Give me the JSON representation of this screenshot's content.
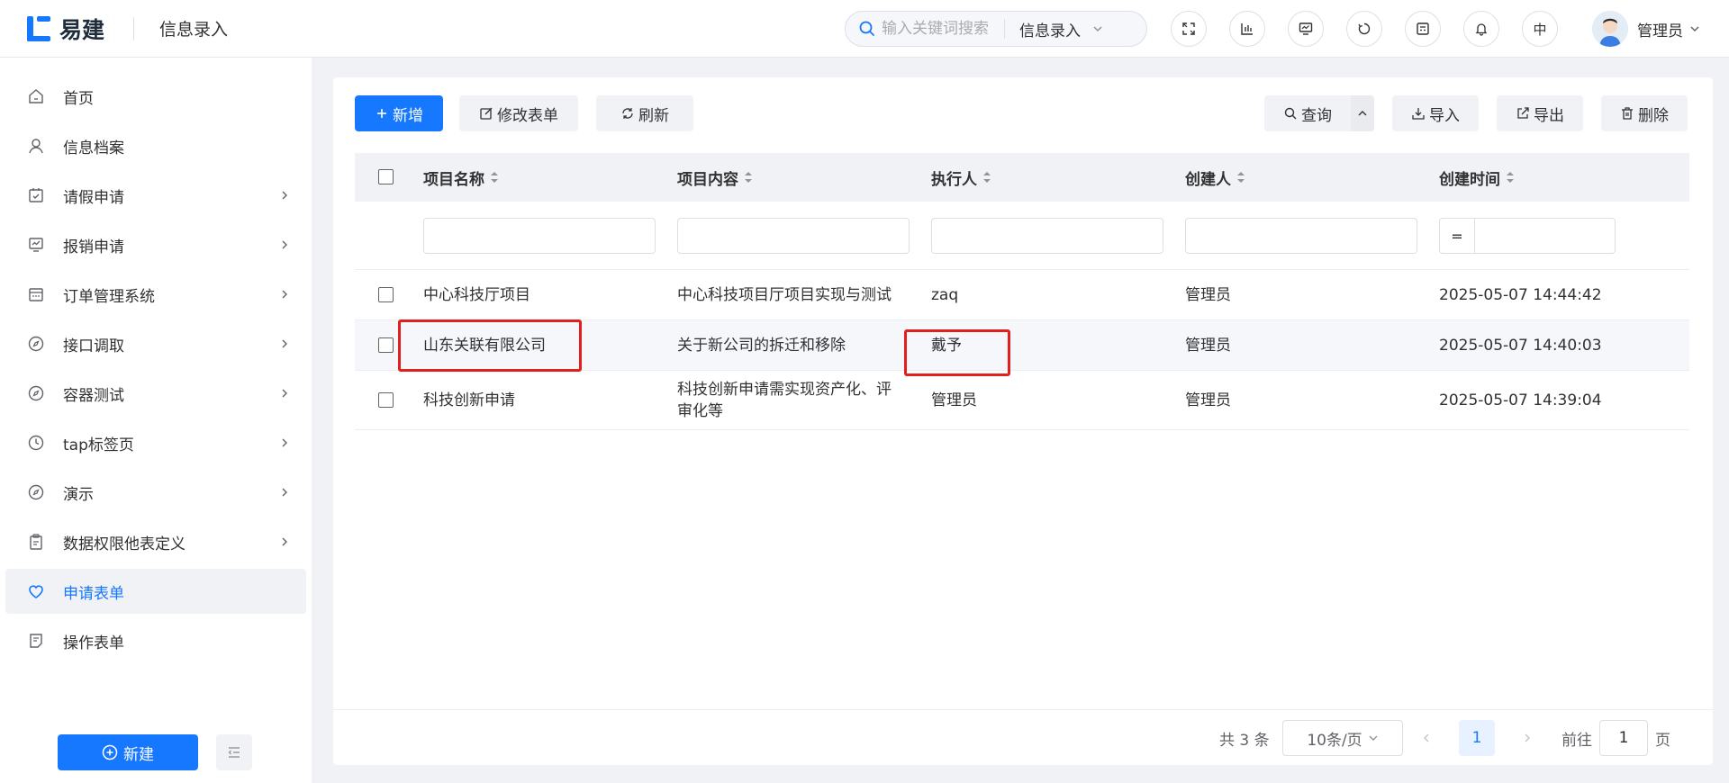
{
  "header": {
    "logo_text": "易建",
    "section_title": "信息录入",
    "search_placeholder": "输入关键词搜索",
    "search_scope": "信息录入",
    "lang_label": "中",
    "user_name": "管理员"
  },
  "sidebar": {
    "items": [
      {
        "label": "首页",
        "icon": "home-icon",
        "has_children": false
      },
      {
        "label": "信息档案",
        "icon": "user-icon",
        "has_children": false
      },
      {
        "label": "请假申请",
        "icon": "calendar-check-icon",
        "has_children": true
      },
      {
        "label": "报销申请",
        "icon": "chart-board-icon",
        "has_children": true
      },
      {
        "label": "订单管理系统",
        "icon": "calendar-icon",
        "has_children": true
      },
      {
        "label": "接口调取",
        "icon": "compass-icon",
        "has_children": true
      },
      {
        "label": "容器测试",
        "icon": "compass-icon",
        "has_children": true
      },
      {
        "label": "tap标签页",
        "icon": "clock-icon",
        "has_children": true
      },
      {
        "label": "演示",
        "icon": "compass-icon",
        "has_children": true
      },
      {
        "label": "数据权限他表定义",
        "icon": "clipboard-icon",
        "has_children": true
      },
      {
        "label": "申请表单",
        "icon": "heart-icon",
        "has_children": false,
        "active": true
      },
      {
        "label": "操作表单",
        "icon": "form-icon",
        "has_children": false
      }
    ],
    "new_button": "新建"
  },
  "toolbar": {
    "add": "新增",
    "edit_form": "修改表单",
    "refresh": "刷新",
    "query": "查询",
    "import": "导入",
    "export": "导出",
    "delete": "删除"
  },
  "table": {
    "columns": [
      "项目名称",
      "项目内容",
      "执行人",
      "创建人",
      "创建时间"
    ],
    "filter_operator": "=",
    "rows": [
      {
        "name": "中心科技厅项目",
        "content": "中心科技项目厅项目实现与测试",
        "executor": "zaq",
        "creator": "管理员",
        "created": "2025-05-07 14:44:42"
      },
      {
        "name": "山东关联有限公司",
        "content": "关于新公司的拆迁和移除",
        "executor": "戴予",
        "creator": "管理员",
        "created": "2025-05-07 14:40:03"
      },
      {
        "name": "科技创新申请",
        "content_line1": "科技创新申请需实现资产化、评",
        "content_line2": "审化等",
        "executor": "管理员",
        "creator": "管理员",
        "created": "2025-05-07 14:39:04"
      }
    ]
  },
  "pagination": {
    "total": "共 3 条",
    "page_size": "10条/页",
    "current_page": "1",
    "goto_label": "前往",
    "goto_value": "1",
    "page_suffix": "页"
  },
  "colors": {
    "accent": "#1677ff",
    "highlight": "#e0201f"
  }
}
